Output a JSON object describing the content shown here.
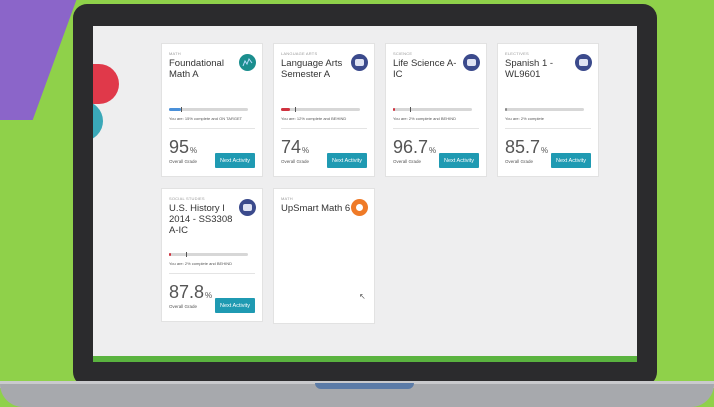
{
  "cards": [
    {
      "category": "MATH",
      "title": "Foundational Math A",
      "status": "You are: 15% complete and ON TARGET",
      "grade": "95",
      "grade_unit": "%",
      "grade_label": "Overall Grade",
      "button": "Next Activity",
      "progress": 0.15,
      "progress_color": "#4a90d9",
      "icon": "chart-icon"
    },
    {
      "category": "LANGUAGE ARTS",
      "title": "Language Arts Semester A",
      "status": "You are: 12% complete and BEHIND",
      "grade": "74",
      "grade_unit": "%",
      "grade_label": "Overall Grade",
      "button": "Next Activity",
      "progress": 0.12,
      "progress_color": "#d0323f",
      "icon": "laptop-icon"
    },
    {
      "category": "SCIENCE",
      "title": "Life Science A-IC",
      "status": "You are: 2% complete and BEHIND",
      "grade": "96.7",
      "grade_unit": "%",
      "grade_label": "Overall Grade",
      "button": "Next Activity",
      "progress": 0.02,
      "progress_color": "#d0323f",
      "icon": "laptop-icon"
    },
    {
      "category": "ELECTIVES",
      "title": "Spanish 1 - WL9601",
      "status": "You are: 2% complete",
      "grade": "85.7",
      "grade_unit": "%",
      "grade_label": "Overall Grade",
      "button": "Next Activity",
      "progress": 0.02,
      "progress_color": "#888888",
      "icon": "laptop-icon"
    },
    {
      "category": "SOCIAL STUDIES",
      "title": "U.S. History I 2014 - SS3308 A-IC",
      "status": "You are: 2% complete and BEHIND",
      "grade": "87.8",
      "grade_unit": "%",
      "grade_label": "Overall Grade",
      "button": "Next Activity",
      "progress": 0.02,
      "progress_color": "#d0323f",
      "icon": "laptop-icon"
    },
    {
      "category": "MATH",
      "title": "UpSmart Math 6",
      "icon": "upsmart-logo-icon"
    }
  ]
}
